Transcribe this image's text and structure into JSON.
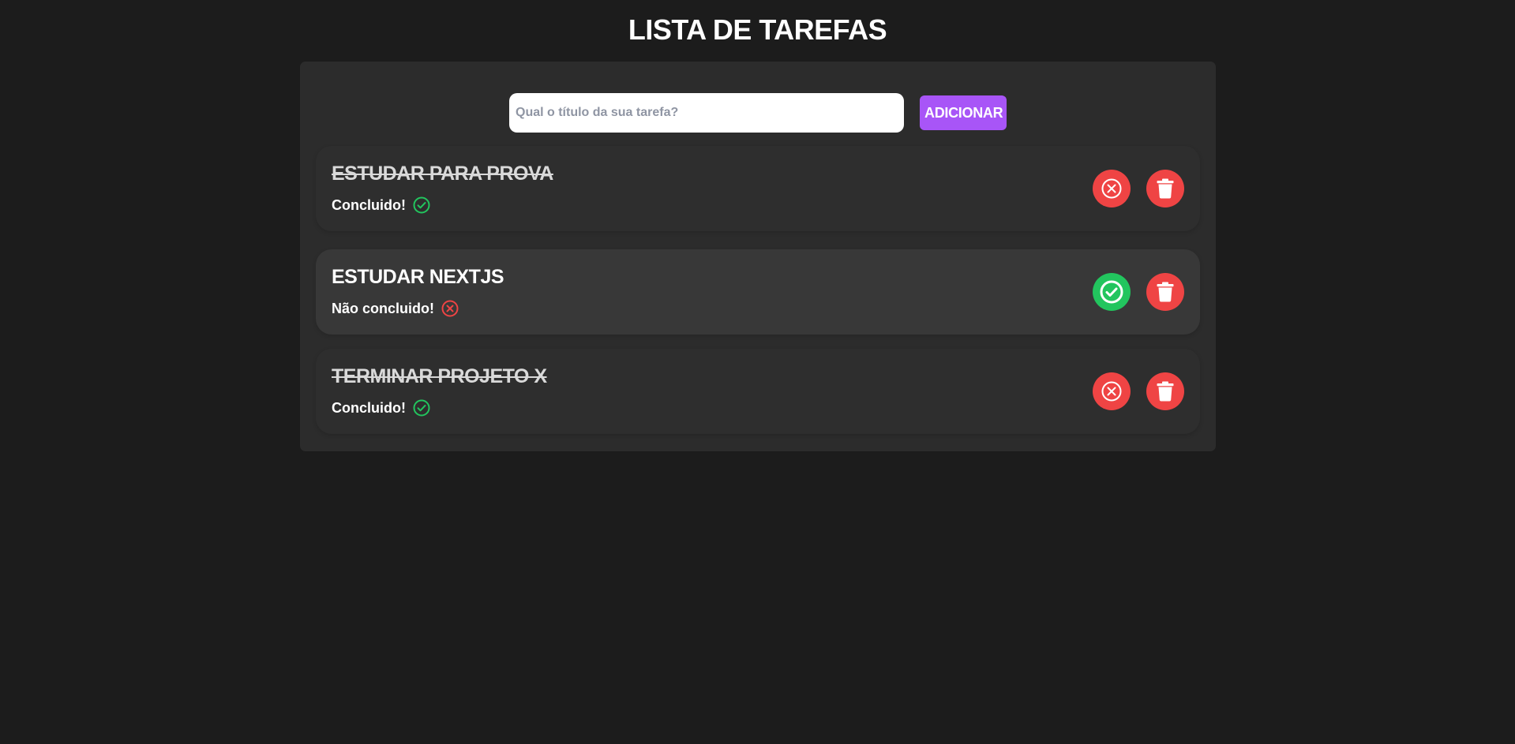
{
  "header": {
    "title": "LISTA DE TAREFAS"
  },
  "form": {
    "placeholder": "Qual o título da sua tarefa?",
    "value": "",
    "add_label": "ADICIONAR"
  },
  "tasks": [
    {
      "title": "ESTUDAR PARA PROVA",
      "completed": true,
      "status_label": "Concluido!",
      "status_icon": "check-circle-icon",
      "toggle_icon": "x-circle-icon",
      "delete_icon": "trash-icon"
    },
    {
      "title": "ESTUDAR NEXTJS",
      "completed": false,
      "status_label": "Não concluido!",
      "status_icon": "x-circle-icon",
      "toggle_icon": "check-circle-icon",
      "delete_icon": "trash-icon"
    },
    {
      "title": "TERMINAR PROJETO X",
      "completed": true,
      "status_label": "Concluido!",
      "status_icon": "check-circle-icon",
      "toggle_icon": "x-circle-icon",
      "delete_icon": "trash-icon"
    }
  ],
  "colors": {
    "background": "#1c1c1c",
    "panel": "#2c2c2c",
    "accent": "#a855f7",
    "success": "#22c55e",
    "danger": "#ef4444"
  }
}
